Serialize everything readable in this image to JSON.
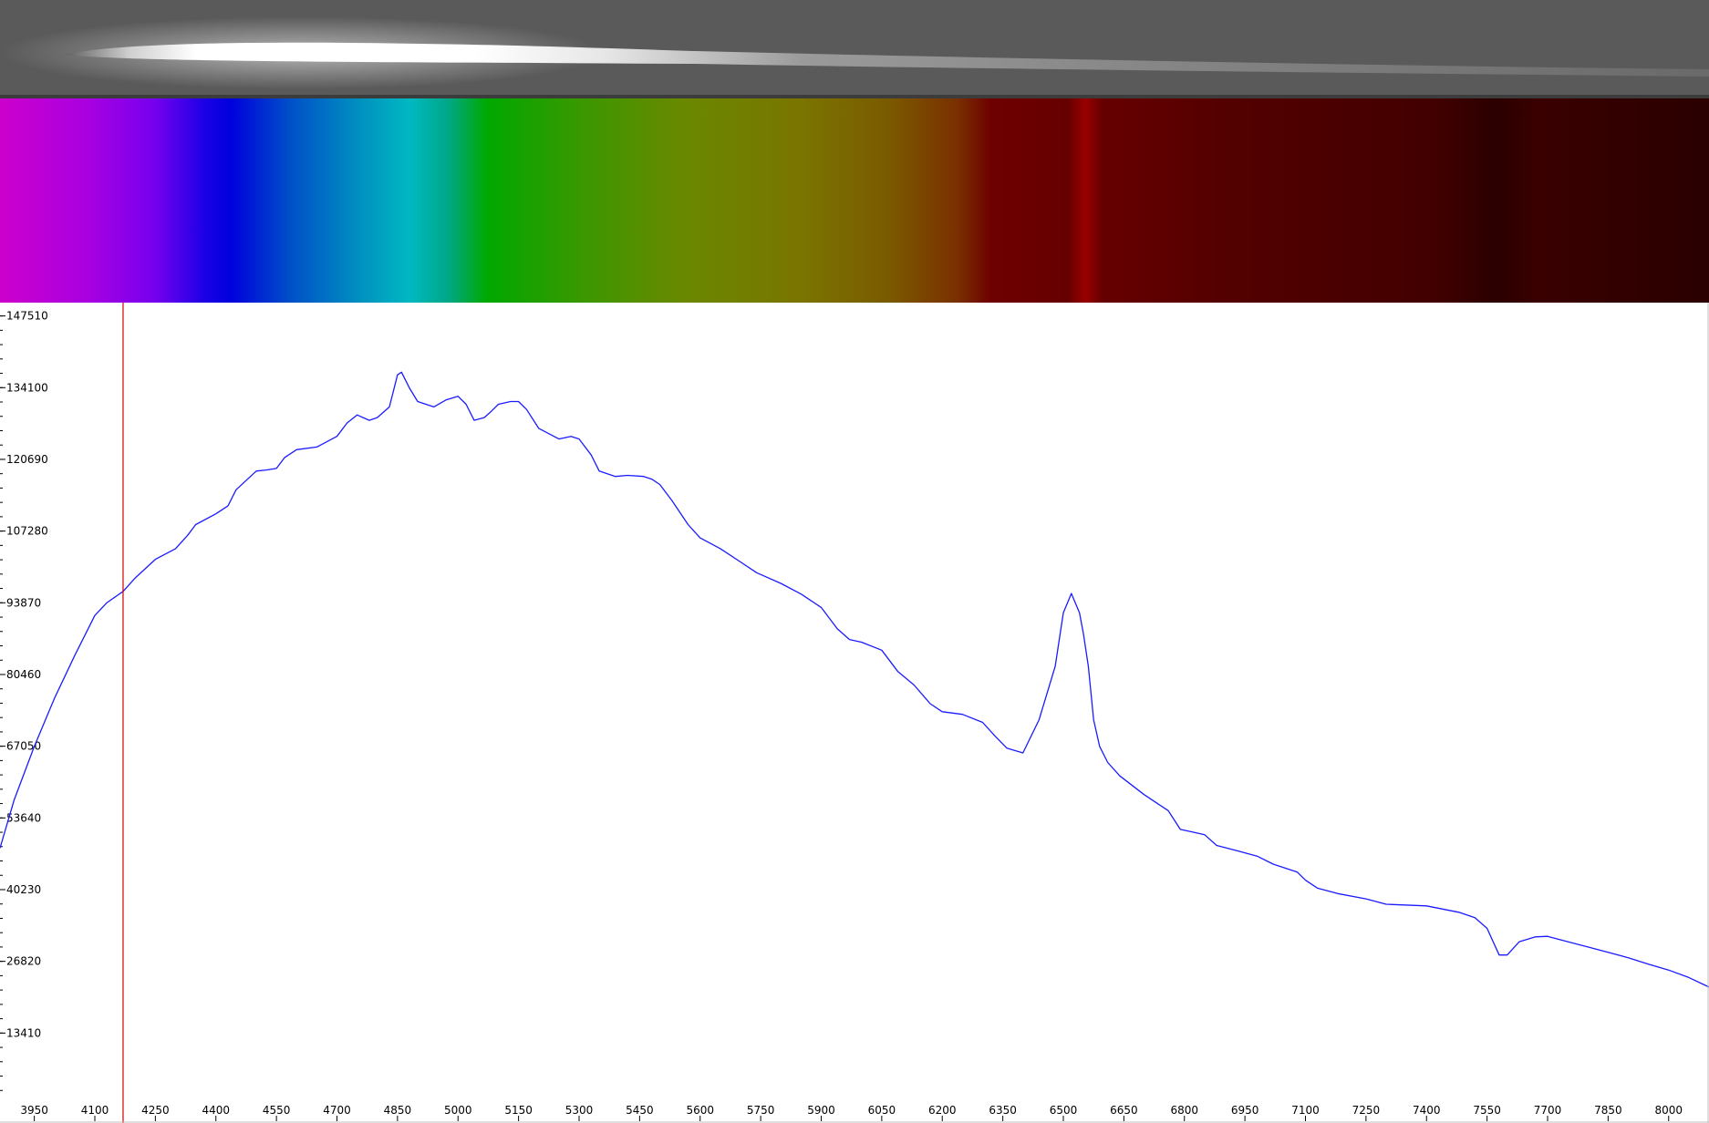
{
  "colors": {
    "spectrum_line": "#1b1bff",
    "cursor_line": "#cc0000",
    "axis": "#000000",
    "background": "#ffffff"
  },
  "chart_data": {
    "type": "line",
    "title": "",
    "xlabel": "",
    "ylabel": "",
    "xlim": [
      3865,
      8100
    ],
    "ylim": [
      0,
      150000
    ],
    "grid": false,
    "legend": "none",
    "x_ticks": [
      3950,
      4100,
      4250,
      4400,
      4550,
      4700,
      4850,
      5000,
      5150,
      5300,
      5450,
      5600,
      5750,
      5900,
      6050,
      6200,
      6350,
      6500,
      6650,
      6800,
      6950,
      7100,
      7250,
      7400,
      7550,
      7700,
      7850,
      8000
    ],
    "y_ticks": [
      13410,
      26820,
      40230,
      53640,
      67050,
      80460,
      93870,
      107280,
      120690,
      134100,
      147510
    ],
    "cursor_x": 4170,
    "series": [
      {
        "name": "",
        "x": [
          3865,
          3900,
          3950,
          4000,
          4050,
          4100,
          4130,
          4170,
          4200,
          4250,
          4300,
          4330,
          4350,
          4400,
          4430,
          4450,
          4500,
          4525,
          4550,
          4570,
          4600,
          4650,
          4700,
          4725,
          4750,
          4780,
          4800,
          4830,
          4850,
          4860,
          4880,
          4900,
          4940,
          4970,
          5000,
          5020,
          5040,
          5065,
          5080,
          5100,
          5130,
          5150,
          5170,
          5200,
          5250,
          5280,
          5300,
          5330,
          5350,
          5390,
          5420,
          5460,
          5480,
          5500,
          5530,
          5570,
          5600,
          5650,
          5700,
          5740,
          5800,
          5850,
          5900,
          5940,
          5970,
          6000,
          6050,
          6090,
          6130,
          6170,
          6200,
          6250,
          6300,
          6330,
          6360,
          6400,
          6440,
          6480,
          6500,
          6520,
          6540,
          6550,
          6562,
          6575,
          6590,
          6610,
          6640,
          6700,
          6760,
          6790,
          6820,
          6850,
          6880,
          6930,
          6980,
          7020,
          7080,
          7100,
          7130,
          7180,
          7250,
          7300,
          7400,
          7480,
          7520,
          7550,
          7580,
          7600,
          7630,
          7670,
          7700,
          7750,
          7800,
          7850,
          7900,
          7950,
          8000,
          8050,
          8100
        ],
        "y": [
          48000,
          57000,
          67000,
          76000,
          84000,
          91500,
          93900,
          96000,
          98500,
          102000,
          104000,
          106500,
          108500,
          110500,
          112000,
          115000,
          118500,
          118700,
          119000,
          121000,
          122500,
          123000,
          125000,
          127500,
          129000,
          128000,
          128500,
          130500,
          136500,
          137000,
          134000,
          131500,
          130500,
          131800,
          132500,
          131000,
          128000,
          128500,
          129500,
          131000,
          131500,
          131500,
          130000,
          126500,
          124500,
          125000,
          124500,
          121500,
          118500,
          117500,
          117700,
          117500,
          117000,
          116000,
          113000,
          108500,
          106000,
          104000,
          101500,
          99500,
          97500,
          95500,
          93000,
          89000,
          87000,
          86500,
          85000,
          81000,
          78500,
          75000,
          73500,
          73000,
          71500,
          69000,
          66700,
          65800,
          72000,
          82000,
          92000,
          95600,
          92000,
          88000,
          82000,
          72000,
          67000,
          64000,
          61500,
          58000,
          55000,
          51500,
          51000,
          50500,
          48500,
          47500,
          46500,
          45000,
          43500,
          42000,
          40500,
          39500,
          38500,
          37500,
          37200,
          36000,
          35000,
          33000,
          28000,
          28000,
          30500,
          31400,
          31500,
          30500,
          29500,
          28500,
          27500,
          26300,
          25200,
          23800,
          22000
        ]
      }
    ]
  }
}
